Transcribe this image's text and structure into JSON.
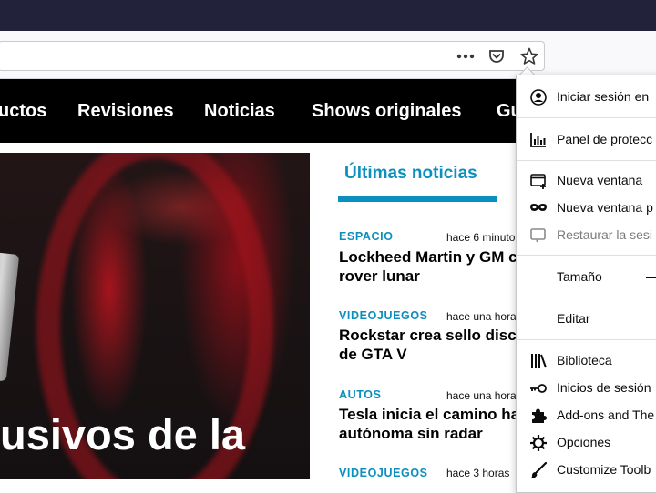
{
  "browser": {
    "page_actions_icon": "more-horizontal-icon",
    "pocket_icon": "pocket-icon",
    "bookmark_icon": "star-icon"
  },
  "site_nav": {
    "items": [
      "uctos",
      "Revisiones",
      "Noticias",
      "Shows originales",
      "Gu"
    ]
  },
  "hero": {
    "title": "usivos de la"
  },
  "news": {
    "heading": "Últimas noticias",
    "items": [
      {
        "category": "ESPACIO",
        "time": "hace 6 minuto",
        "title": "Lockheed Martin y GM c\nrover lunar"
      },
      {
        "category": "VIDEOJUEGOS",
        "time": "hace una hora",
        "title": "Rockstar crea sello disc\nde GTA V"
      },
      {
        "category": "AUTOS",
        "time": "hace una hora",
        "title": "Tesla inicia el camino ha\nautónoma sin radar"
      },
      {
        "category": "VIDEOJUEGOS",
        "time": "hace 3 horas",
        "title": ""
      }
    ]
  },
  "menu": {
    "items": [
      {
        "label": "Iniciar sesión en",
        "icon": "account-icon"
      },
      {
        "label": "Panel de protecc",
        "icon": "dashboard-icon"
      },
      {
        "label": "Nueva ventana",
        "icon": "new-window-icon"
      },
      {
        "label": "Nueva ventana p",
        "icon": "private-mask-icon"
      },
      {
        "label": "Restaurar la sesi",
        "icon": "restore-session-icon"
      },
      {
        "label": "Tamaño",
        "icon": "zoom-out-icon"
      },
      {
        "label": "Editar",
        "icon": ""
      },
      {
        "label": "Biblioteca",
        "icon": "library-icon"
      },
      {
        "label": "Inicios de sesión",
        "icon": "key-icon"
      },
      {
        "label": "Add-ons and The",
        "icon": "puzzle-icon"
      },
      {
        "label": "Opciones",
        "icon": "gear-icon"
      },
      {
        "label": "Customize Toolb",
        "icon": "brush-icon"
      }
    ]
  },
  "colors": {
    "accent": "#0b8fbf",
    "titlebar": "#22233a",
    "sitenav": "#000000"
  }
}
